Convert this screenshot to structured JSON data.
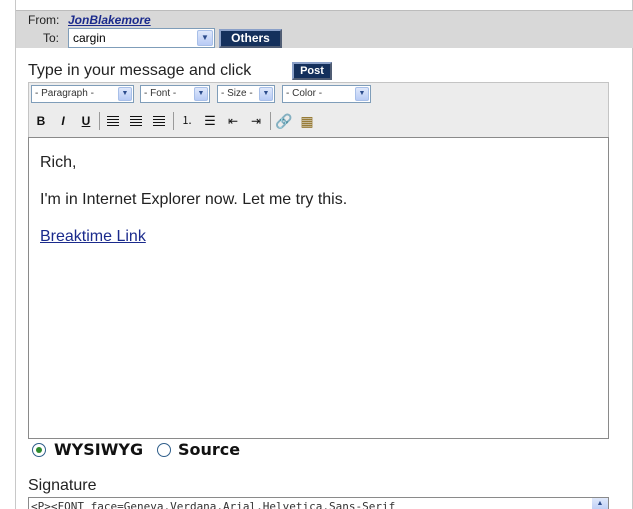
{
  "header": {
    "from_label": "From:",
    "from_name": "JonBlakemore",
    "to_label": "To:",
    "to_value": "cargin",
    "others_label": "Others"
  },
  "compose": {
    "instruction": "Type in your message and click",
    "post_label": "Post"
  },
  "toolbar": {
    "paragraph": "- Paragraph -",
    "font": "- Font -",
    "size": "- Size -",
    "color": "- Color -",
    "bold": "B",
    "italic": "I",
    "underline": "U"
  },
  "editor": {
    "line1": "Rich,",
    "line2": "I'm in Internet Explorer now.  Let me try this.",
    "link": "Breaktime Link"
  },
  "mode": {
    "wysiwyg": "WYSIWYG",
    "source": "Source",
    "selected": "WYSIWYG"
  },
  "signature": {
    "label": "Signature",
    "value": "<P><FONT face=Geneva,Verdana,Arial,Helvetica,Sans-Serif"
  },
  "colors": {
    "button_bg": "#14305c",
    "header_bg": "#d8d8d8",
    "link": "#1a2a8c"
  }
}
